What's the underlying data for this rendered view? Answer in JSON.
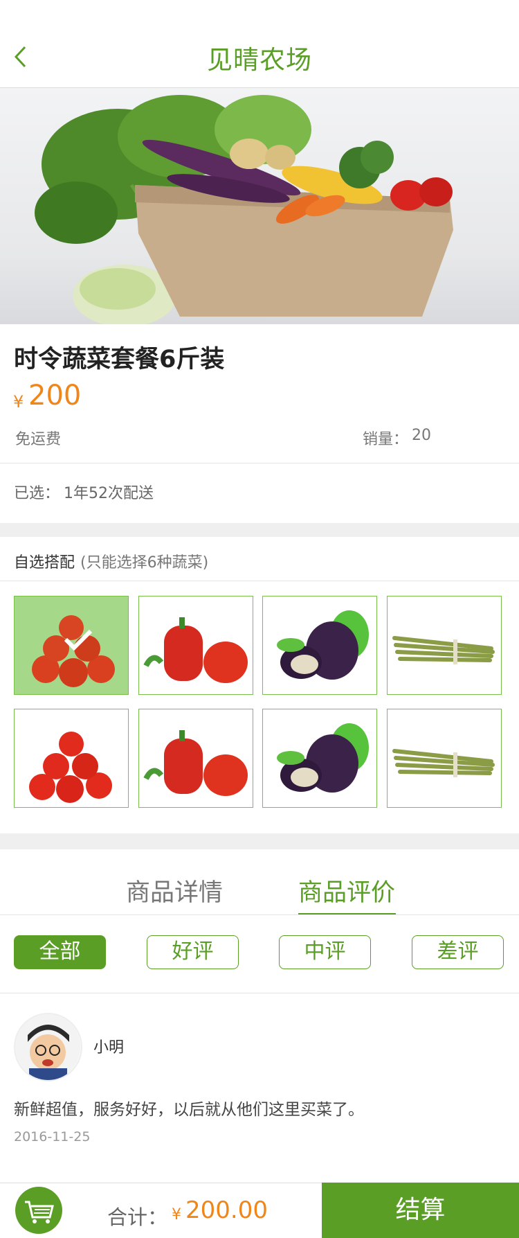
{
  "header": {
    "title": "见晴农场"
  },
  "product": {
    "name": "时令蔬菜套餐6斤装",
    "currency": "¥",
    "price": "200",
    "shipping": "免运费",
    "sales_label": "销量：",
    "sales_value": "20",
    "selected_label": "已选：",
    "selected_value": "1年52次配送"
  },
  "mix": {
    "title": "自选搭配",
    "note": "(只能选择6种蔬菜)",
    "items": [
      {
        "veg": "tomato-icon",
        "selected": true
      },
      {
        "veg": "pepper-icon",
        "selected": false
      },
      {
        "veg": "eggplant-icon",
        "selected": false
      },
      {
        "veg": "asparagus-icon",
        "selected": false
      },
      {
        "veg": "tomato-icon",
        "selected": false
      },
      {
        "veg": "pepper-icon",
        "selected": false
      },
      {
        "veg": "eggplant-icon",
        "selected": false
      },
      {
        "veg": "asparagus-icon",
        "selected": false
      }
    ]
  },
  "tabs": {
    "details": "商品详情",
    "reviews": "商品评价",
    "active": "reviews"
  },
  "filters": {
    "all": "全部",
    "good": "好评",
    "mid": "中评",
    "bad": "差评",
    "active": "all"
  },
  "review": {
    "user": "小明",
    "text": "新鲜超值，服务好好，以后就从他们这里买菜了。",
    "date": "2016-11-25"
  },
  "footer": {
    "total_label": "合计：",
    "currency": "¥",
    "total": "200.00",
    "checkout": "结算"
  },
  "colors": {
    "brand_green": "#5a9e26",
    "price_orange": "#f08519",
    "cell_border": "#79c04b",
    "selected_bg": "#a6d88a"
  }
}
